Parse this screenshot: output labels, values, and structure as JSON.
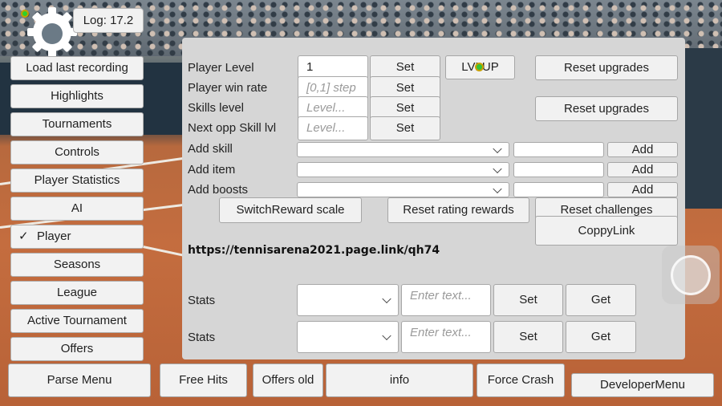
{
  "log": {
    "label": "Log: 17.2"
  },
  "sidebar": {
    "items": [
      {
        "label": "Load last recording",
        "checked": false
      },
      {
        "label": "Highlights",
        "checked": false
      },
      {
        "label": "Tournaments",
        "checked": false
      },
      {
        "label": "Controls",
        "checked": false
      },
      {
        "label": "Player Statistics",
        "checked": false
      },
      {
        "label": "AI",
        "checked": false
      },
      {
        "label": "Player",
        "checked": true
      },
      {
        "label": "Seasons",
        "checked": false
      },
      {
        "label": "League",
        "checked": false
      },
      {
        "label": "Active Tournament",
        "checked": false
      },
      {
        "label": "Offers",
        "checked": false
      }
    ],
    "check_glyph": "✓"
  },
  "panel": {
    "player_level": {
      "label": "Player Level",
      "value": "1",
      "set": "Set"
    },
    "player_win_rate": {
      "label": "Player win rate",
      "placeholder": "[0,1] step",
      "set": "Set"
    },
    "skills_level": {
      "label": "Skills level",
      "placeholder": "Level...",
      "set": "Set"
    },
    "next_opp": {
      "label": "Next opp Skill lvl",
      "placeholder": "Level...",
      "set": "Set"
    },
    "lvl_up": "LVLUP",
    "reset_upgrades_1": "Reset upgrades",
    "reset_upgrades_2": "Reset upgrades",
    "add_skill": {
      "label": "Add skill",
      "add": "Add"
    },
    "add_item": {
      "label": "Add item",
      "add": "Add"
    },
    "add_boosts": {
      "label": "Add boosts",
      "add": "Add"
    },
    "switch_reward": "SwitchReward scale",
    "reset_rating": "Reset rating rewards",
    "reset_challenges": "Reset challenges",
    "copy_link": "CoppyLink",
    "link": "https://tennisarena2021.page.link/qh74",
    "stats": [
      {
        "label": "Stats",
        "placeholder": "Enter text...",
        "set": "Set",
        "get": "Get"
      },
      {
        "label": "Stats",
        "placeholder": "Enter text...",
        "set": "Set",
        "get": "Get"
      }
    ]
  },
  "bottom_bar": {
    "parse_menu": "Parse Menu",
    "free_hits": "Free Hits",
    "offers_old": "Offers old",
    "info": "info",
    "force_crash": "Force Crash",
    "developer_menu": "DeveloperMenu"
  }
}
